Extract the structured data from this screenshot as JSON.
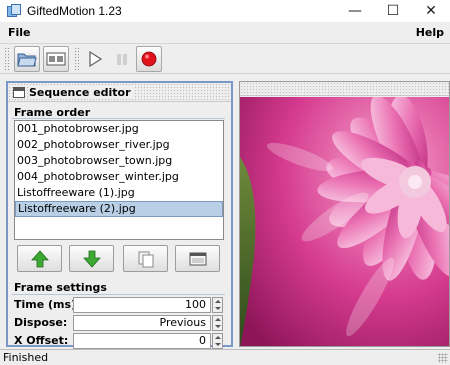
{
  "window": {
    "title": "GiftedMotion 1.23",
    "minimize_glyph": "—",
    "maximize_glyph": "☐",
    "close_glyph": "✕"
  },
  "menu": {
    "file": "File",
    "help": "Help"
  },
  "toolbar": {
    "buttons": [
      {
        "name": "open-folder-icon"
      },
      {
        "name": "frames-icon"
      },
      {
        "name": "play-icon"
      },
      {
        "name": "pause-icon"
      },
      {
        "name": "record-icon"
      }
    ]
  },
  "sequence_editor": {
    "title": "Sequence editor",
    "frame_order_title": "Frame order",
    "frames": [
      "001_photobrowser.jpg",
      "002_photobrowser_river.jpg",
      "003_photobrowser_town.jpg",
      "004_photobrowser_winter.jpg",
      "Listoffreeware (1).jpg",
      "Listoffreeware (2).jpg"
    ],
    "selected_index": 5,
    "actions": [
      "move-up",
      "move-down",
      "copy",
      "delete"
    ],
    "frame_settings": {
      "title": "Frame settings",
      "time_label": "Time (ms):",
      "time_value": "100",
      "dispose_label": "Dispose:",
      "dispose_value": "Previous",
      "xoffset_label": "X Offset:",
      "xoffset_value": "0"
    }
  },
  "status": {
    "text": "Finished"
  },
  "colors": {
    "panel_border": "#7a98c8",
    "selection": "#b8cfe5",
    "arrow_green": "#3da832",
    "record_red": "#e0121b",
    "flower_pink": "#d63b8f"
  }
}
